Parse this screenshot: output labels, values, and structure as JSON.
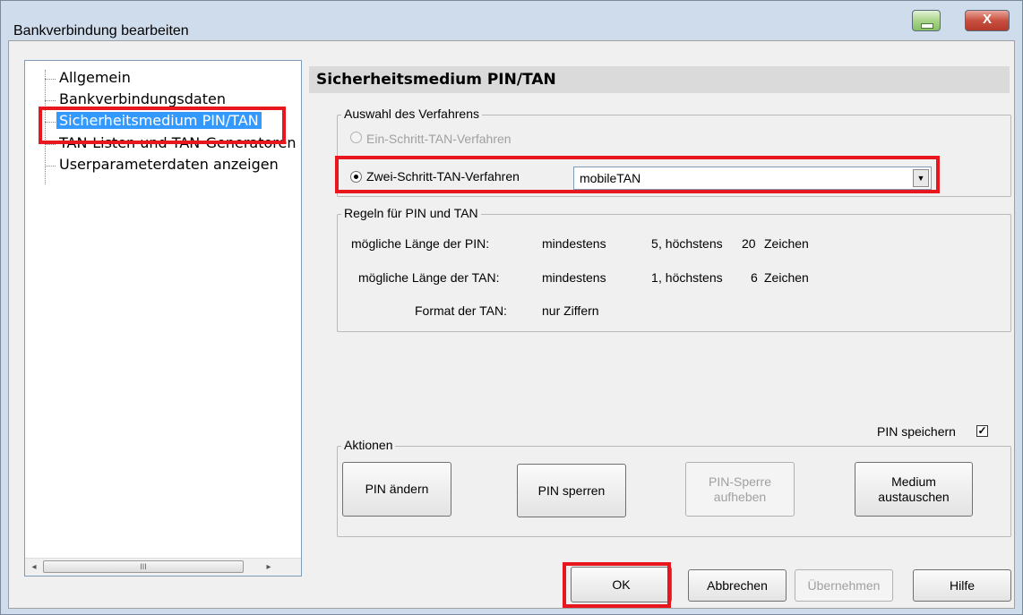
{
  "window": {
    "title": "Bankverbindung bearbeiten",
    "close_symbol": "X"
  },
  "tree": {
    "items": [
      {
        "label": "Allgemein"
      },
      {
        "label": "Bankverbindungsdaten"
      },
      {
        "label": "Sicherheitsmedium PIN/TAN",
        "selected": true
      },
      {
        "label": "TAN-Listen und TAN-Generatoren"
      },
      {
        "label": "Userparameterdaten anzeigen"
      }
    ],
    "scroll_left": "◂",
    "scroll_right": "▸",
    "scroll_grip": "III"
  },
  "section_title": "Sicherheitsmedium PIN/TAN",
  "verfahren": {
    "group_label": "Auswahl des Verfahrens",
    "option1_label": "Ein-Schritt-TAN-Verfahren",
    "option1_enabled": false,
    "option2_label": "Zwei-Schritt-TAN-Verfahren",
    "option2_checked": true,
    "select_value": "mobileTAN",
    "dropdown_symbol": "▼"
  },
  "regeln": {
    "group_label": "Regeln für PIN und TAN",
    "pin_label": "mögliche Länge der PIN:",
    "pin_min_label": "mindestens",
    "pin_min": "5",
    "pin_max_label": ", höchstens",
    "pin_max": "20",
    "pin_unit": "Zeichen",
    "tan_label": "mögliche Länge der TAN:",
    "tan_min_label": "mindestens",
    "tan_min": "1",
    "tan_max_label": ", höchstens",
    "tan_max": "6",
    "tan_unit": "Zeichen",
    "format_label": "Format der TAN:",
    "format_value": "nur Ziffern"
  },
  "pin_speichern": {
    "label": "PIN speichern",
    "checked": true,
    "check_symbol": "✓"
  },
  "aktionen": {
    "group_label": "Aktionen",
    "btn_pin_aendern": "PIN ändern",
    "btn_pin_sperren": "PIN sperren",
    "btn_sperre_aufheben_1": "PIN-Sperre",
    "btn_sperre_aufheben_2": "aufheben",
    "btn_medium_1": "Medium",
    "btn_medium_2": "austauschen"
  },
  "footer": {
    "ok": "OK",
    "cancel": "Abbrechen",
    "apply": "Übernehmen",
    "help": "Hilfe"
  },
  "colors": {
    "highlight_red": "#e8161d",
    "selection_blue": "#3399ff"
  }
}
